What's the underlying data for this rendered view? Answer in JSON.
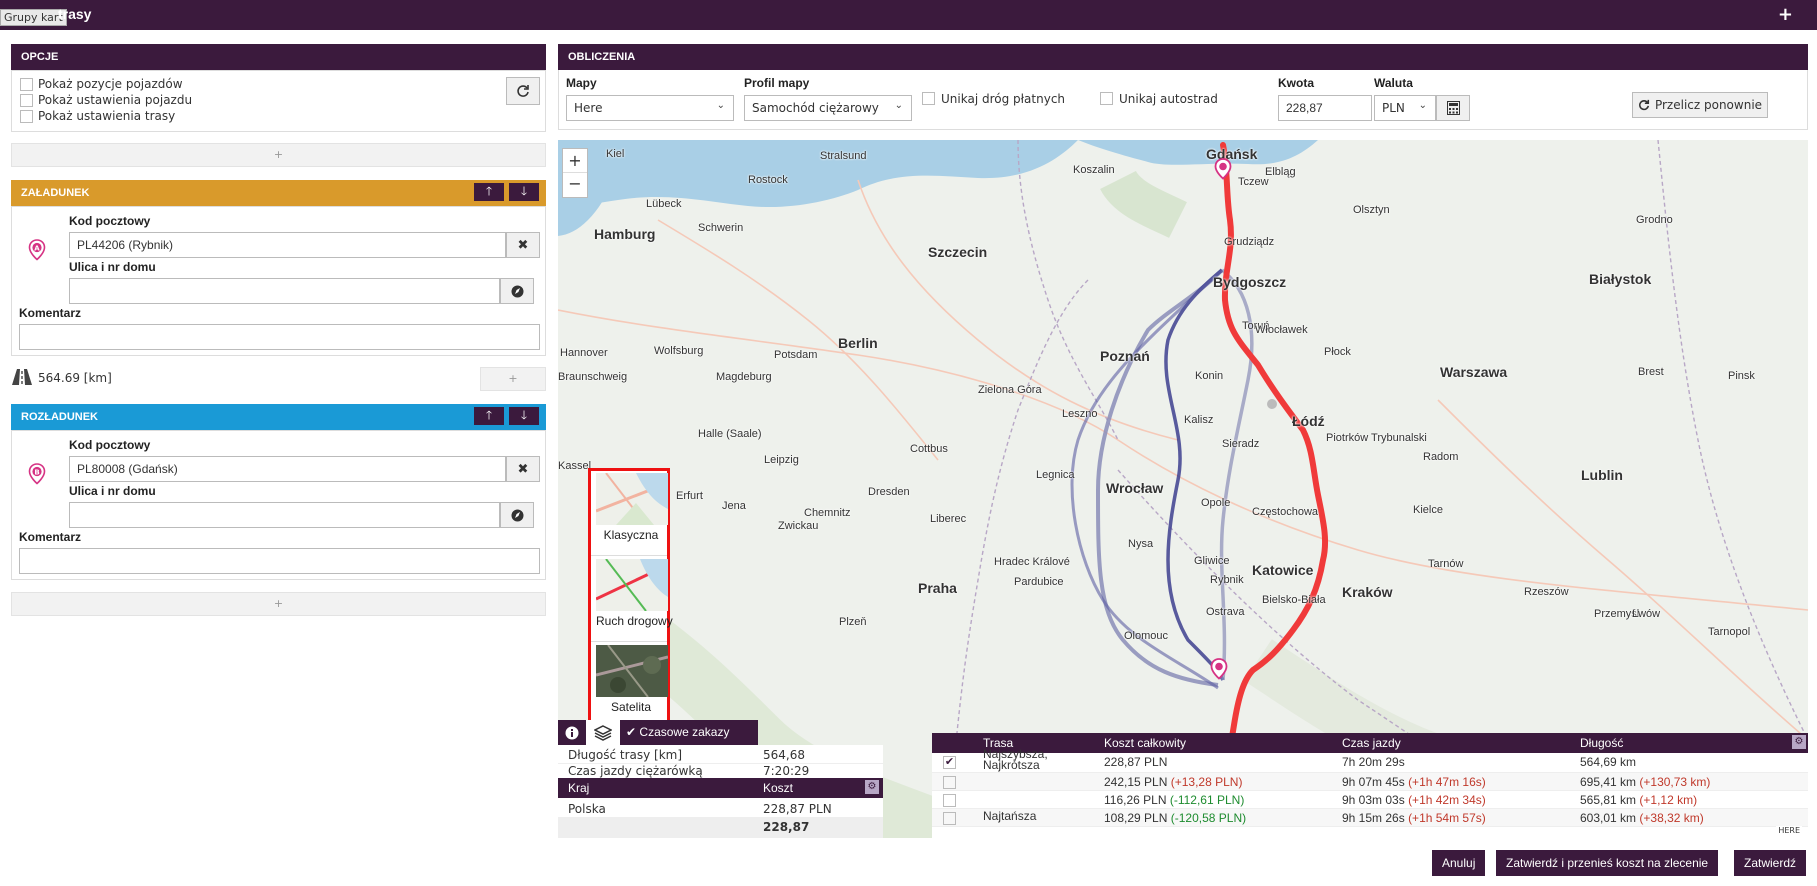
{
  "app": {
    "tooltip": "Grupy kart",
    "title": "trasy",
    "add_label": "+"
  },
  "options": {
    "header": "OPCJE",
    "items": [
      "Pokaż pozycje pojazdów",
      "Pokaż ustawienia pojazdu",
      "Pokaż ustawienia trasy"
    ],
    "add_label": "+"
  },
  "loading": {
    "header": "ZAŁADUNEK",
    "marker": "A",
    "postcode_label": "Kod pocztowy",
    "postcode_value": "PL44206 (Rybnik)",
    "street_label": "Ulica i nr domu",
    "street_value": "",
    "comment_label": "Komentarz",
    "comment_value": ""
  },
  "distance": {
    "text": "564.69 [km]",
    "add_label": "+"
  },
  "unloading": {
    "header": "ROZŁADUNEK",
    "marker": "B",
    "postcode_label": "Kod pocztowy",
    "postcode_value": "PL80008 (Gdańsk)",
    "street_label": "Ulica i nr domu",
    "street_value": "",
    "comment_label": "Komentarz",
    "comment_value": "",
    "add_label": "+"
  },
  "calc": {
    "header": "OBLICZENIA",
    "maps_label": "Mapy",
    "maps_value": "Here",
    "profile_label": "Profil mapy",
    "profile_value": "Samochód ciężarowy",
    "avoid_tolls": "Unikaj dróg płatnych",
    "avoid_highways": "Unikaj autostrad",
    "amount_label": "Kwota",
    "amount_value": "228,87",
    "currency_label": "Waluta",
    "currency_value": "PLN",
    "recalc_label": "Przelicz ponownie"
  },
  "map": {
    "zoom_in": "+",
    "zoom_out": "−",
    "layers": [
      "Klasyczna",
      "Ruch drogowy",
      "Satelita"
    ],
    "time_restrictions": "Czasowe zakazy",
    "attribution": "HERE",
    "cities": [
      "Gdańsk",
      "Elbląg",
      "Kiel",
      "Rostock",
      "Koszalin",
      "Stralsund",
      "Hamburg",
      "Lübeck",
      "Schwerin",
      "Szczecin",
      "Bydgoszcz",
      "Toruń",
      "Olsztyn",
      "Białystok",
      "Berlin",
      "Poznań",
      "Włocławek",
      "Płock",
      "Warszawa",
      "Hannover",
      "Wolfsburg",
      "Magdeburg",
      "Braunschweig",
      "Potsdam",
      "Zielona Góra",
      "Łódź",
      "Kalisz",
      "Leszno",
      "Halle (Saale)",
      "Leipzig",
      "Cottbus",
      "Radom",
      "Lublin",
      "Wrocław",
      "Legnica",
      "Opole",
      "Częstochowa",
      "Kielce",
      "Dresden",
      "Chemnitz",
      "Liberec",
      "Katowice",
      "Kraków",
      "Rzeszów",
      "Praha",
      "Rybnik",
      "Ostrava",
      "Bielsko-Biała",
      "Olomouc",
      "Plzeň",
      "Gliwice",
      "Tarnów",
      "Przemyśl",
      "Lwów",
      "Grudziądz",
      "Tczew",
      "Konin",
      "Sieradz",
      "Piotrków Trybunalski",
      "Nysa",
      "Kassel",
      "Erfurt",
      "Jena",
      "Zwickau",
      "Hradec Králové",
      "Pardubice",
      "Brest",
      "Pinsk",
      "Grodno",
      "Tarnopol"
    ]
  },
  "summary": {
    "rows": [
      {
        "label": "Długość trasy [km]",
        "value": "564,68"
      },
      {
        "label": "Czas jazdy ciężarówką",
        "value": "7:20:29"
      }
    ],
    "country_header": "Kraj",
    "cost_header": "Koszt",
    "countries": [
      {
        "country": "Polska",
        "cost": "228,87 PLN"
      }
    ],
    "total": "228,87"
  },
  "routes": {
    "headers": [
      "Trasa",
      "Koszt całkowity",
      "Czas jazdy",
      "Długość"
    ],
    "rows": [
      {
        "name": "Najszybsza, Najkrótsza",
        "cost": "228,87 PLN",
        "cost_diff": "",
        "time": "7h 20m 29s",
        "time_diff": "",
        "length": "564,69 km",
        "length_diff": "",
        "checked": true
      },
      {
        "name": "",
        "cost": "242,15 PLN",
        "cost_diff": "(+13,28 PLN)",
        "time": "9h 07m 45s",
        "time_diff": "(+1h 47m 16s)",
        "length": "695,41 km",
        "length_diff": "(+130,73 km)",
        "checked": false
      },
      {
        "name": "",
        "cost": "116,26 PLN",
        "cost_diff": "(-112,61 PLN)",
        "time": "9h 03m 03s",
        "time_diff": "(+1h 42m 34s)",
        "length": "565,81 km",
        "length_diff": "(+1,12 km)",
        "checked": false
      },
      {
        "name": "Najtańsza",
        "cost": "108,29 PLN",
        "cost_diff": "(-120,58 PLN)",
        "time": "9h 15m 26s",
        "time_diff": "(+1h 54m 57s)",
        "length": "603,01 km",
        "length_diff": "(+38,32 km)",
        "checked": false
      }
    ]
  },
  "footer": {
    "cancel": "Anuluj",
    "confirm_transfer": "Zatwierdź i przenieś koszt na zlecenie",
    "confirm": "Zatwierdź"
  },
  "colors": {
    "brand": "#3b1a3d",
    "loading": "#d99a2b",
    "unloading": "#1a9ad6",
    "route_main": "#f03a3a",
    "route_alt_dark": "#3d3f8f",
    "route_alt_light": "#8a8db8",
    "negative": "#c0392b",
    "positive": "#1e8c2f"
  }
}
